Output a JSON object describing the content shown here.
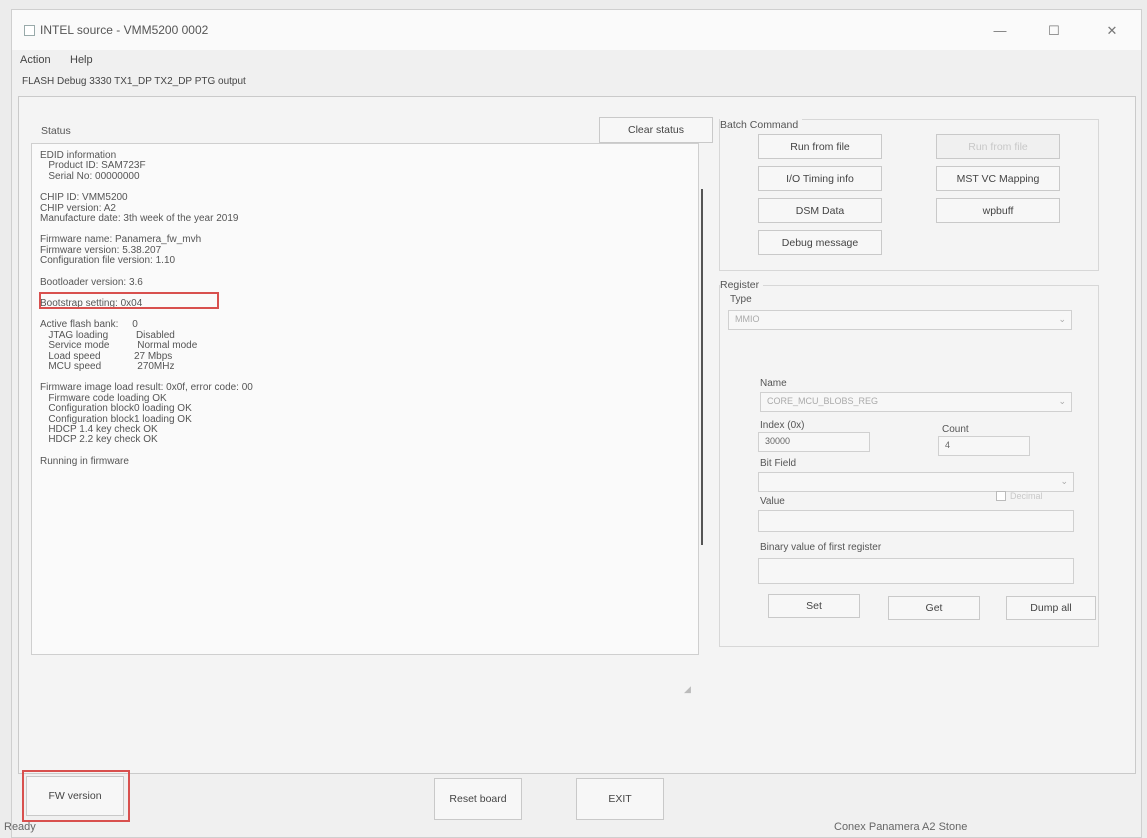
{
  "window": {
    "title": "INTEL source - VMM5200 0002",
    "minimize": "—",
    "maximize": "☐",
    "close": "✕"
  },
  "menu": {
    "action": "Action",
    "help": "Help"
  },
  "tab_text": "FLASH  Debug 3330  TX1_DP TX2_DP PTG output",
  "status": {
    "title": "Status",
    "clear_button": "Clear status",
    "lines": [
      "EDID information",
      "   Product ID: SAM723F",
      "   Serial No: 00000000",
      "",
      "CHIP ID: VMM5200",
      "CHIP version: A2",
      "Manufacture date: 3th week of the year 2019",
      "",
      "Firmware name: Panamera_fw_mvh",
      "Firmware version: 5.38.207",
      "Configuration file version: 1.10",
      "",
      "Bootloader version: 3.6",
      "",
      "Bootstrap setting: 0x04",
      "",
      "Active flash bank:     0",
      "   JTAG loading          Disabled",
      "   Service mode          Normal mode",
      "   Load speed            27 Mbps",
      "   MCU speed             270MHz",
      "",
      "Firmware image load result: 0x0f, error code: 00",
      "   Firmware code loading OK",
      "   Configuration block0 loading OK",
      "   Configuration block1 loading OK",
      "   HDCP 1.4 key check OK",
      "   HDCP 2.2 key check OK",
      "",
      "Running in firmware"
    ]
  },
  "batch": {
    "title": "Batch Command",
    "run_from_file": "Run from file",
    "disabled_button": "Run from file",
    "timing_info": "I/O Timing info",
    "mst_vc_mapping": "MST VC Mapping",
    "dsm_data": "DSM Data",
    "wpbuff": "wpbuff",
    "debug_message": "Debug message"
  },
  "register": {
    "title": "Register",
    "type_label": "Type",
    "type_value": "MMIO",
    "name_label": "Name",
    "name_value": "CORE_MCU_BLOBS_REG",
    "index_label": "Index (0x)",
    "index_value": "30000",
    "count_label": "Count",
    "count_value": "4",
    "bitfield_label": "Bit Field",
    "value_label": "Value",
    "hex_checkbox_label": "Decimal",
    "binary_label": "Binary value of first register",
    "set_button": "Set",
    "get_button": "Get",
    "dump_button": "Dump all"
  },
  "bottom": {
    "fw_version_button": "FW version",
    "reset_board_button": "Reset board",
    "exit_button": "EXIT"
  },
  "statusbar": {
    "left": "Ready",
    "right": "Conex Panamera A2   Stone"
  },
  "colors": {
    "highlight": "#d8504e"
  }
}
